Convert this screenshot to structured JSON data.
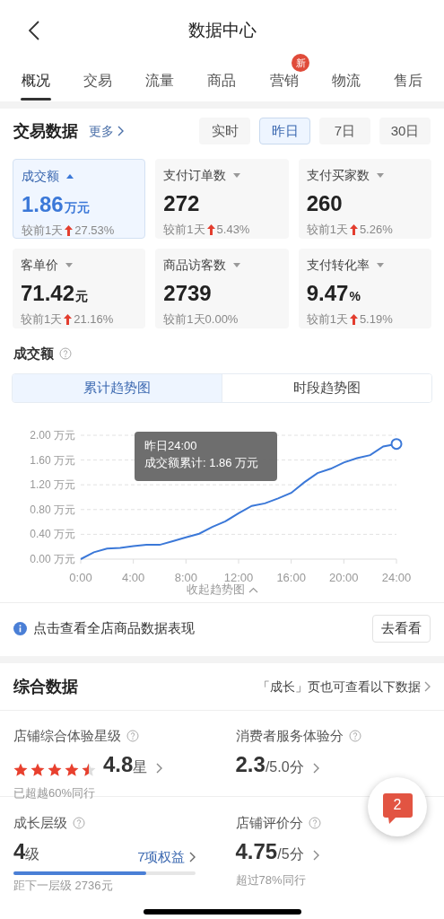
{
  "header": {
    "title": "数据中心"
  },
  "tabs": [
    {
      "label": "概况",
      "selected": true
    },
    {
      "label": "交易",
      "selected": false
    },
    {
      "label": "流量",
      "selected": false
    },
    {
      "label": "商品",
      "selected": false
    },
    {
      "label": "营销",
      "selected": false,
      "badge": "新"
    },
    {
      "label": "物流",
      "selected": false
    },
    {
      "label": "售后",
      "selected": false
    }
  ],
  "trade": {
    "title": "交易数据",
    "more": "更多",
    "periods": [
      {
        "label": "实时",
        "selected": false
      },
      {
        "label": "昨日",
        "selected": true
      },
      {
        "label": "7日",
        "selected": false
      },
      {
        "label": "30日",
        "selected": false
      }
    ],
    "metrics": [
      {
        "label": "成交额",
        "value": "1.86",
        "unit": "万元",
        "compare": "较前1天",
        "rising": true,
        "change": "27.53%",
        "selected": true
      },
      {
        "label": "支付订单数",
        "value": "272",
        "compare": "较前1天",
        "rising": true,
        "change": "5.43%",
        "selected": false
      },
      {
        "label": "支付买家数",
        "value": "260",
        "compare": "较前1天",
        "rising": true,
        "change": "5.26%",
        "selected": false
      },
      {
        "label": "客单价",
        "value": "71.42",
        "unit": "元",
        "compare": "较前1天",
        "rising": true,
        "change": "21.16%",
        "selected": false
      },
      {
        "label": "商品访客数",
        "value": "2739",
        "compare": "较前1天",
        "rising": false,
        "change": "0.00%",
        "selected": false
      },
      {
        "label": "支付转化率",
        "value": "9.47",
        "unit": "%",
        "compare": "较前1天",
        "rising": true,
        "change": "5.19%",
        "selected": false
      }
    ]
  },
  "trend": {
    "title": "成交额",
    "views": [
      {
        "label": "累计趋势图",
        "selected": true
      },
      {
        "label": "时段趋势图",
        "selected": false
      }
    ],
    "chart_data": {
      "type": "line",
      "x": [
        0,
        1,
        2,
        3,
        4,
        5,
        6,
        7,
        8,
        9,
        10,
        11,
        12,
        13,
        14,
        15,
        16,
        17,
        18,
        19,
        20,
        21,
        22,
        23,
        24
      ],
      "series": [
        {
          "color": "#3b78d8",
          "values": [
            0,
            0.11,
            0.17,
            0.18,
            0.21,
            0.23,
            0.23,
            0.29,
            0.35,
            0.41,
            0.52,
            0.61,
            0.74,
            0.86,
            0.9,
            0.98,
            1.07,
            1.24,
            1.39,
            1.46,
            1.56,
            1.63,
            1.68,
            1.82,
            1.86
          ]
        }
      ],
      "xlim": [
        0,
        24
      ],
      "ylim": [
        0,
        2
      ],
      "grid": true,
      "yticks": [
        {
          "value": 0,
          "label": "0.00 万元"
        },
        {
          "value": 0.4,
          "label": "0.40 万元"
        },
        {
          "value": 0.8,
          "label": "0.80 万元"
        },
        {
          "value": 1.2,
          "label": "1.20 万元"
        },
        {
          "value": 1.6,
          "label": "1.60 万元"
        },
        {
          "value": 2,
          "label": "2.00 万元"
        }
      ],
      "xticks": [
        {
          "value": 0,
          "label": "0:00"
        },
        {
          "value": 4,
          "label": "4:00"
        },
        {
          "value": 8,
          "label": "8:00"
        },
        {
          "value": 12,
          "label": "12:00"
        },
        {
          "value": 16,
          "label": "16:00"
        },
        {
          "value": 20,
          "label": "20:00"
        },
        {
          "value": 24,
          "label": "24:00"
        }
      ]
    },
    "tooltip": {
      "title": "昨日24:00",
      "text": "成交额累计: 1.86 万元"
    },
    "collapse": "收起趋势图"
  },
  "notice": {
    "text": "点击查看全店商品数据表现",
    "button": "去看看"
  },
  "summary": {
    "title": "综合数据",
    "link": "「成长」页也可查看以下数据",
    "items": [
      {
        "kind": "stars",
        "label": "店铺综合体验星级",
        "stars": 4.5,
        "value": "4.8",
        "unit": "星",
        "note": "已超越60%同行"
      },
      {
        "kind": "score",
        "label": "消费者服务体验分",
        "value": "2.3",
        "unit": "/5.0分"
      },
      {
        "kind": "level",
        "label": "成长层级",
        "value": "4",
        "unit": "级",
        "benefit": "7项权益",
        "level": 0.73,
        "note": "距下一层级 2736元"
      },
      {
        "kind": "score",
        "label": "店铺评价分",
        "value": "4.75",
        "unit": "/5分",
        "note": "超过78%同行"
      }
    ]
  },
  "float": {
    "count": "2"
  }
}
